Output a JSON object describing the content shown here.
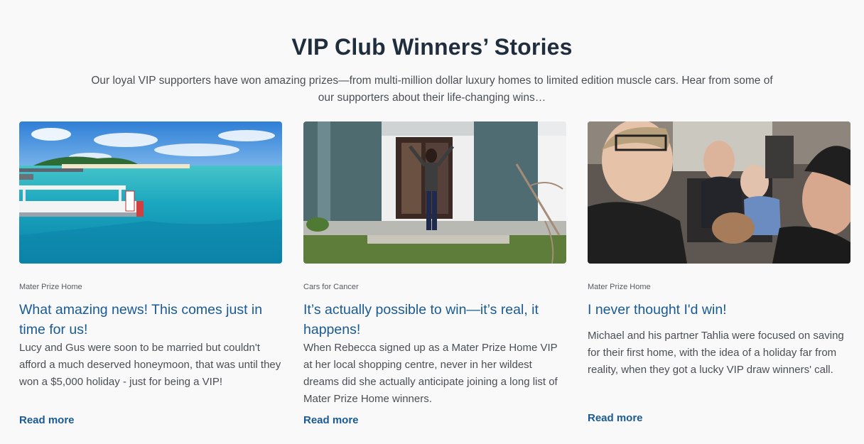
{
  "section": {
    "title": "VIP Club Winners’ Stories",
    "intro": "Our loyal VIP supporters have won amazing prizes—from multi-million dollar luxury homes to limited edition muscle cars. Hear from some of our supporters about their life-changing wins…"
  },
  "stories": [
    {
      "category": "Mater Prize Home",
      "title": "What amazing news!  This comes just in time for us!",
      "excerpt": "Lucy and Gus were soon to be married but couldn't afford a much deserved honeymoon, that was until they won a $5,000 holiday - just for being a VIP!",
      "read_more": "Read more",
      "image": "tropical-island-boat-photo"
    },
    {
      "category": "Cars for Cancer",
      "title": "It’s actually possible to win—it’s real, it happens!",
      "excerpt": "When Rebecca signed up as a Mater Prize Home VIP at her local shopping centre, never in her wildest dreams did she actually anticipate joining a long list of Mater Prize Home winners.",
      "read_more": "Read more",
      "image": "woman-at-house-entrance-photo"
    },
    {
      "category": "Mater Prize Home",
      "title": "I never thought I'd win!",
      "excerpt": "Michael and his partner Tahlia were focused on saving for their first home, with the idea of a holiday far from reality, when they got a lucky VIP draw winners' call.",
      "read_more": "Read more",
      "image": "group-selfie-in-car-photo"
    }
  ]
}
